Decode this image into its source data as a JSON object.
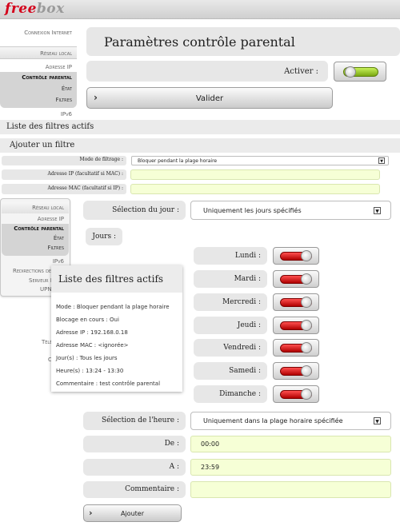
{
  "brand": {
    "logo_part1": "free",
    "logo_part2": "box"
  },
  "sidebar_back": {
    "items": [
      "Connexion Internet",
      "Réseau local",
      "Adresse IP",
      "Contrôle parental",
      "État",
      "Filtres",
      "IPv6"
    ]
  },
  "sidebar_front": {
    "items": [
      "Réseau local",
      "Adresse IP",
      "Contrôle parental",
      "État",
      "Filtres",
      "IPv6",
      "Redirections de",
      "Serveur D",
      "UPNP",
      "Télé",
      "C"
    ]
  },
  "header": {
    "title": "Paramètres contrôle parental",
    "activate_label": "Activer :",
    "validate_label": "Valider"
  },
  "sections": {
    "active_filters": "Liste des filtres actifs",
    "add_filter": "Ajouter un filtre"
  },
  "small_form": {
    "mode_label": "Mode de filtrage :",
    "mode_value": "Bloquer pendant la plage horaire",
    "ip_label": "Adresse IP (facultatif si MAC) :",
    "mac_label": "Adresse MAC (facultatif si IP) :"
  },
  "day_form": {
    "selection_label": "Sélection du jour :",
    "selection_value": "Uniquement les jours spécifiés",
    "days_label": "Jours :",
    "days": [
      "Lundi :",
      "Mardi :",
      "Mercredi :",
      "Jeudi :",
      "Vendredi :",
      "Samedi :",
      "Dimanche :"
    ]
  },
  "time_form": {
    "selection_label": "Sélection de l'heure :",
    "selection_value": "Uniquement dans la plage horaire spécifiée",
    "from_label": "De :",
    "from_value": "00:00",
    "to_label": "A :",
    "to_value": "23:59",
    "comment_label": "Commentaire :",
    "comment_value": "",
    "add_label": "Ajouter"
  },
  "filter_card": {
    "title": "Liste des filtres actifs",
    "lines": [
      "Mode : Bloquer pendant la plage horaire",
      "Blocage en cours : Oui",
      "Adresse IP : 192.168.0.18",
      "Adresse MAC : <ignorée>",
      "Jour(s) : Tous les jours",
      "Heure(s) : 13:24 - 13:30",
      "Commentaire : test contrôle parental"
    ]
  },
  "colors": {
    "brand_red": "#d4001a",
    "toggle_on": "#9fd62a",
    "toggle_off": "#cc0000",
    "input_bg": "#f6ffd6"
  }
}
